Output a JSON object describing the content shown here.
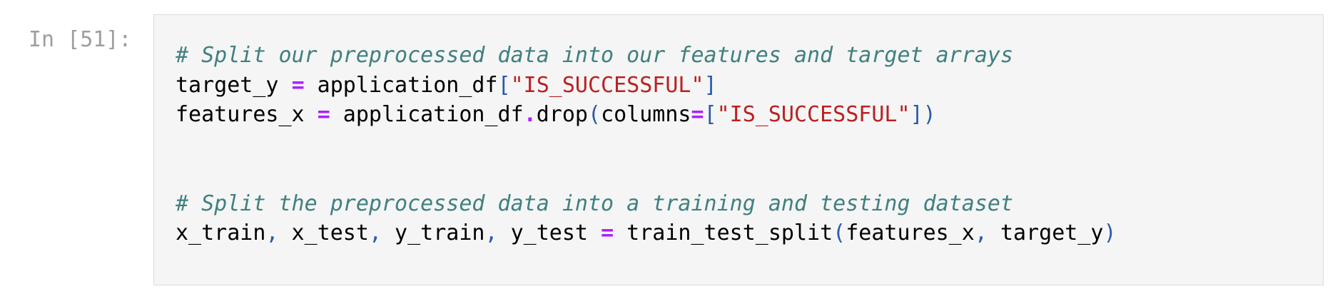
{
  "cell": {
    "prompt": "In [51]:",
    "lines": [
      [
        {
          "t": "# Split our preprocessed data into our features and target arrays",
          "k": "comment"
        }
      ],
      [
        {
          "t": "target_y ",
          "k": "name"
        },
        {
          "t": "=",
          "k": "op"
        },
        {
          "t": " application_df",
          "k": "name"
        },
        {
          "t": "[",
          "k": "punct"
        },
        {
          "t": "\"IS_SUCCESSFUL\"",
          "k": "string"
        },
        {
          "t": "]",
          "k": "punct"
        }
      ],
      [
        {
          "t": "features_x ",
          "k": "name"
        },
        {
          "t": "=",
          "k": "op"
        },
        {
          "t": " application_df",
          "k": "name"
        },
        {
          "t": ".",
          "k": "op"
        },
        {
          "t": "drop",
          "k": "name"
        },
        {
          "t": "(",
          "k": "punct"
        },
        {
          "t": "columns",
          "k": "name"
        },
        {
          "t": "=",
          "k": "op"
        },
        {
          "t": "[",
          "k": "punct"
        },
        {
          "t": "\"IS_SUCCESSFUL\"",
          "k": "string"
        },
        {
          "t": "])",
          "k": "punct"
        }
      ],
      [],
      [],
      [
        {
          "t": "# Split the preprocessed data into a training and testing dataset",
          "k": "comment"
        }
      ],
      [
        {
          "t": "x_train",
          "k": "name"
        },
        {
          "t": ",",
          "k": "punct"
        },
        {
          "t": " x_test",
          "k": "name"
        },
        {
          "t": ",",
          "k": "punct"
        },
        {
          "t": " y_train",
          "k": "name"
        },
        {
          "t": ",",
          "k": "punct"
        },
        {
          "t": " y_test ",
          "k": "name"
        },
        {
          "t": "=",
          "k": "op"
        },
        {
          "t": " train_test_split",
          "k": "name"
        },
        {
          "t": "(",
          "k": "punct"
        },
        {
          "t": "features_x",
          "k": "name"
        },
        {
          "t": ",",
          "k": "punct"
        },
        {
          "t": " target_y",
          "k": "name"
        },
        {
          "t": ")",
          "k": "punct"
        }
      ]
    ]
  },
  "colors": {
    "comment": "#408080",
    "string": "#ba2121",
    "operator": "#aa22ff",
    "punctuation": "#2a5ba8",
    "prompt": "#9e9e9e",
    "cell_background": "#f5f5f5"
  }
}
